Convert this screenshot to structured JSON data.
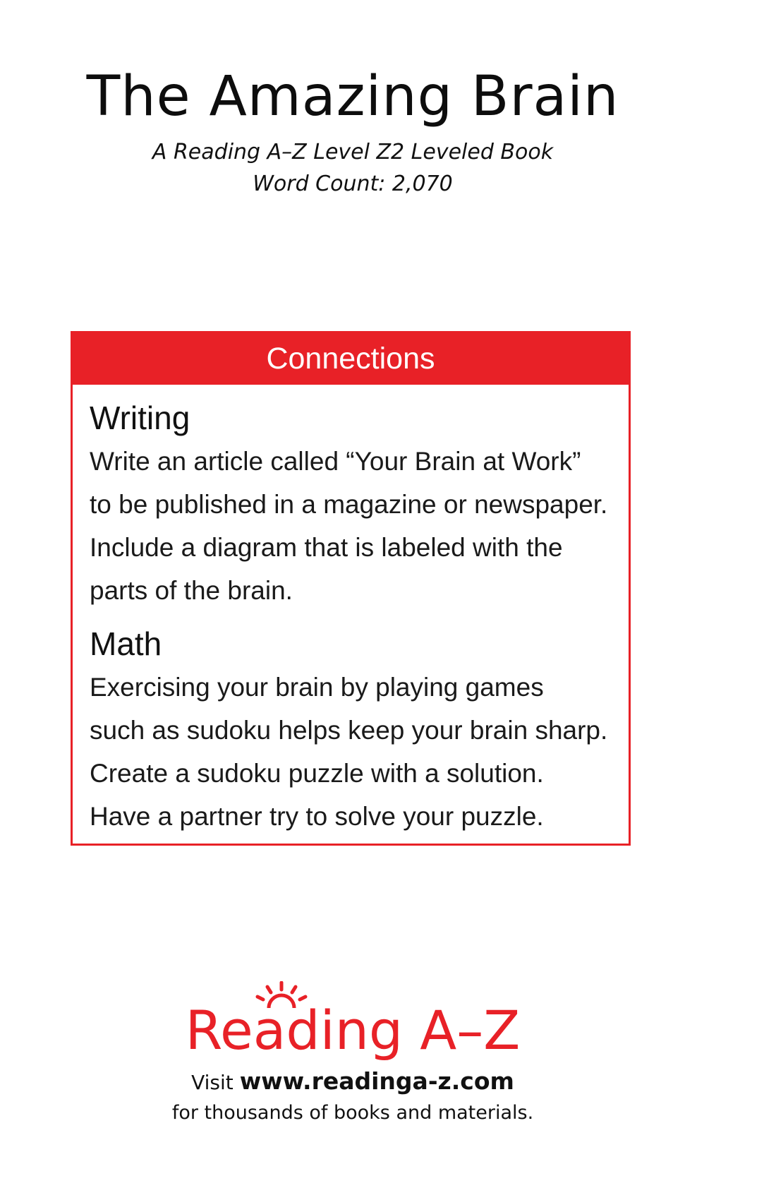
{
  "book": {
    "title": "The Amazing Brain",
    "level_line": "A Reading A–Z Level Z2 Leveled Book",
    "word_count_line": "Word Count: 2,070"
  },
  "connections": {
    "header": "Connections",
    "sections": [
      {
        "title": "Writing",
        "text": "Write an article called “Your Brain at Work”\nto be published in a magazine or newspaper.\nInclude a diagram that is labeled with the\nparts of the brain."
      },
      {
        "title": "Math",
        "text": "Exercising your brain by playing games\nsuch as sudoku helps keep your brain sharp.\nCreate a sudoku puzzle with a solution.\nHave a partner try to solve your puzzle."
      }
    ]
  },
  "footer": {
    "logo_text": "Reading A–Z",
    "visit_prefix": "Visit",
    "url": "www.readinga-z.com",
    "tagline": "for thousands of books and materials."
  },
  "colors": {
    "accent": "#e82127",
    "text": "#111111",
    "background": "#ffffff"
  }
}
